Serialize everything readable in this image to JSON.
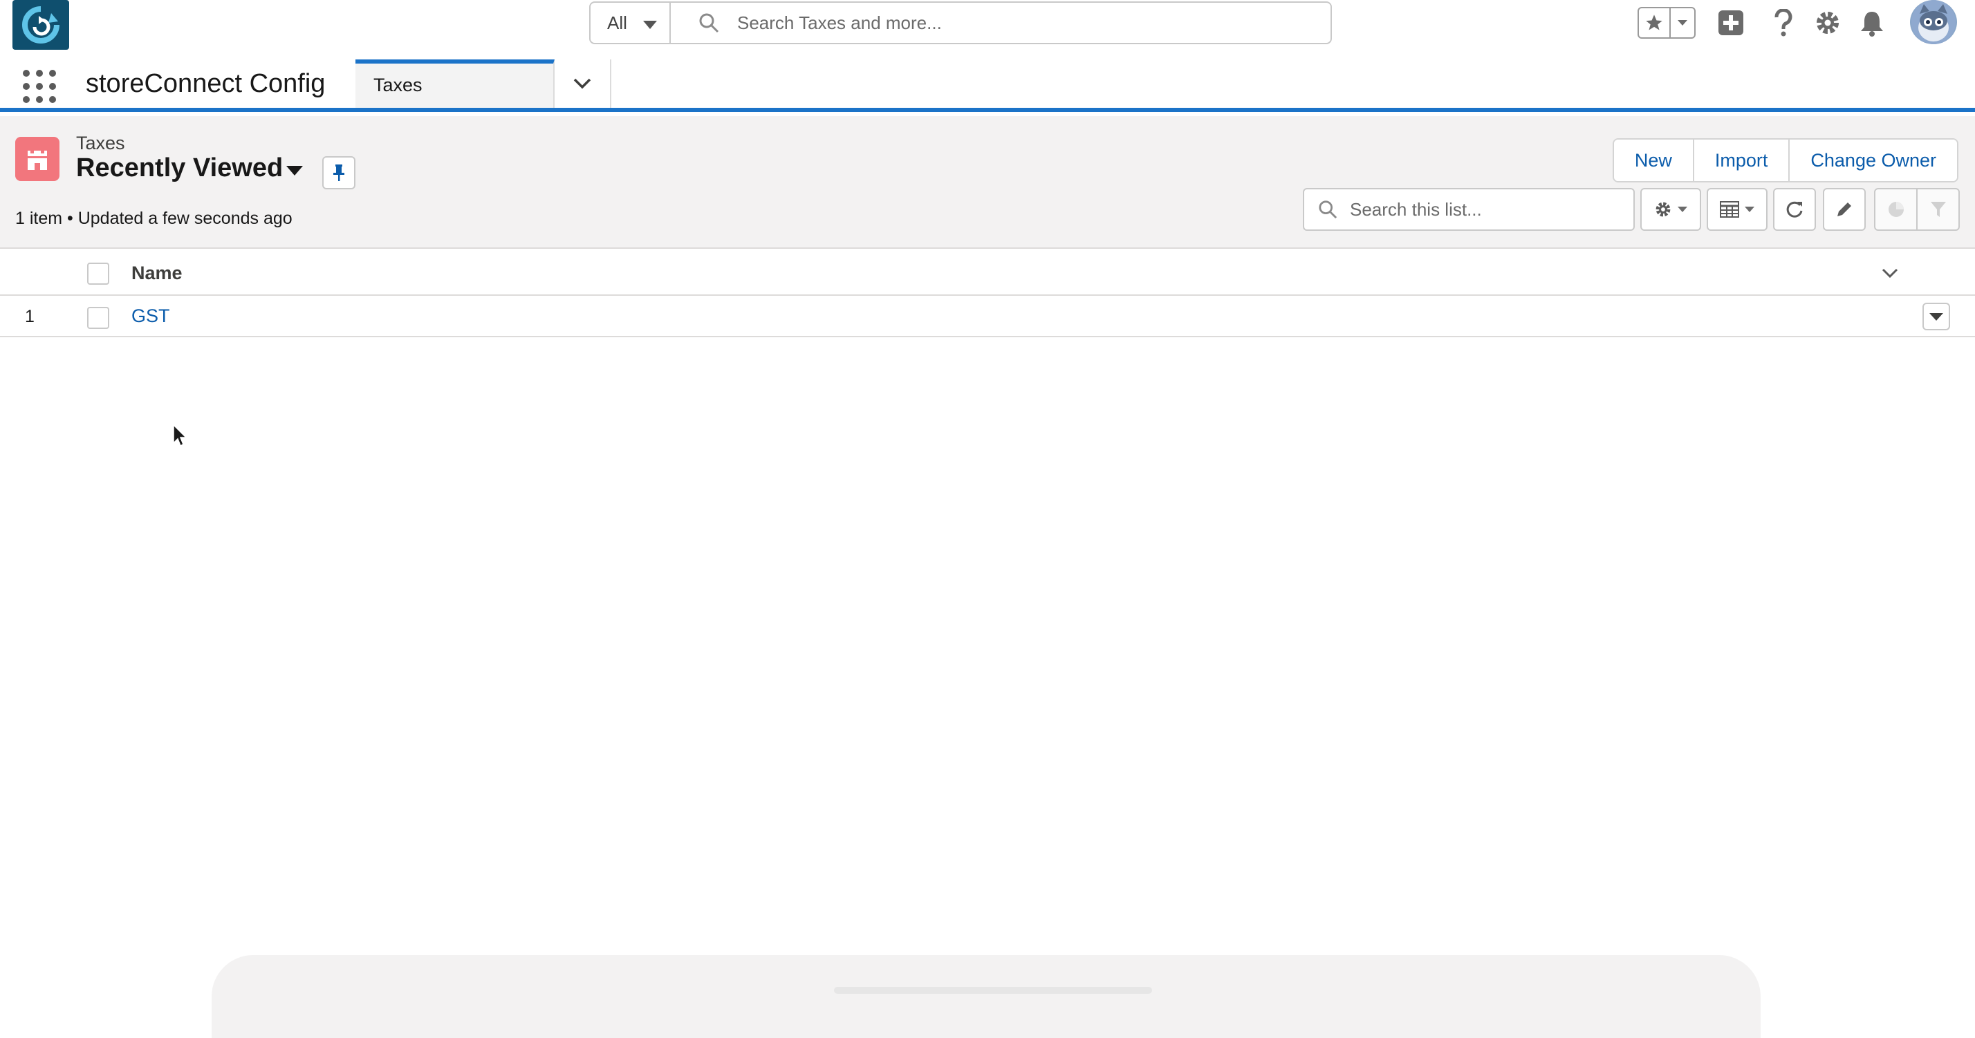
{
  "global_header": {
    "search_scope": "All",
    "search_placeholder": "Search Taxes and more..."
  },
  "app_nav": {
    "app_name": "storeConnect Config",
    "tabs": [
      {
        "label": "Taxes",
        "active": true
      }
    ]
  },
  "list_header": {
    "object_label": "Taxes",
    "list_view_name": "Recently Viewed",
    "meta": "1 item • Updated a few seconds ago",
    "actions": {
      "new": "New",
      "import": "Import",
      "change_owner": "Change Owner"
    },
    "search_placeholder": "Search this list..."
  },
  "table": {
    "columns": [
      {
        "label": "Name"
      }
    ],
    "rows": [
      {
        "number": "1",
        "name": "GST"
      }
    ]
  },
  "colors": {
    "brand_blue": "#1b73c8",
    "link_blue": "#0b5cab",
    "object_icon": "#f2767d",
    "header_bg": "#f3f2f2"
  },
  "icons": {
    "app_logo": "app-logo",
    "search": "search-icon",
    "favorites": "star-icon",
    "global_actions": "plus-icon",
    "help": "help-icon",
    "setup": "gear-icon",
    "notifications": "bell-icon",
    "object": "tax-castle-icon",
    "pin": "pin-icon",
    "list_settings": "gear-icon",
    "display_as": "table-icon",
    "refresh": "refresh-icon",
    "edit": "pencil-icon",
    "charts": "pie-chart-icon",
    "filter": "filter-icon"
  }
}
